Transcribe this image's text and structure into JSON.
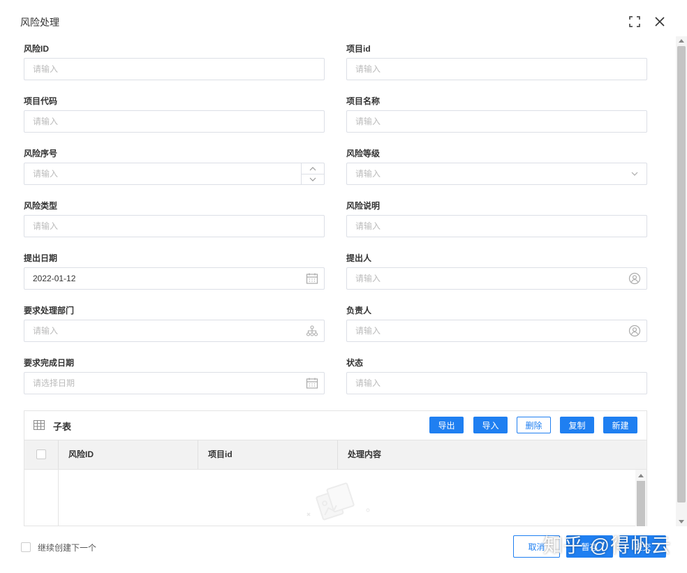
{
  "dialog": {
    "title": "风险处理"
  },
  "fields": {
    "risk_id": {
      "label": "风险ID",
      "placeholder": "请输入"
    },
    "project_id": {
      "label": "项目id",
      "placeholder": "请输入"
    },
    "project_code": {
      "label": "项目代码",
      "placeholder": "请输入"
    },
    "project_name": {
      "label": "项目名称",
      "placeholder": "请输入"
    },
    "risk_seq": {
      "label": "风险序号",
      "placeholder": "请输入"
    },
    "risk_level": {
      "label": "风险等级",
      "placeholder": "请输入"
    },
    "risk_type": {
      "label": "风险类型",
      "placeholder": "请输入"
    },
    "risk_desc": {
      "label": "风险说明",
      "placeholder": "请输入"
    },
    "submit_date": {
      "label": "提出日期",
      "value": "2022-01-12"
    },
    "submitter": {
      "label": "提出人",
      "placeholder": "请输入"
    },
    "required_dept": {
      "label": "要求处理部门",
      "placeholder": "请输入"
    },
    "owner": {
      "label": "负责人",
      "placeholder": "请输入"
    },
    "due_date": {
      "label": "要求完成日期",
      "placeholder": "请选择日期"
    },
    "status": {
      "label": "状态",
      "placeholder": "请输入"
    }
  },
  "subtable": {
    "title": "子表",
    "buttons": {
      "export": "导出",
      "import": "导入",
      "delete": "删除",
      "copy": "复制",
      "new": "新建"
    },
    "columns": [
      "风险ID",
      "项目id",
      "处理内容"
    ]
  },
  "footer": {
    "continue_label": "继续创建下一个",
    "cancel": "取消",
    "save_draft": "暂存",
    "submit": "提交"
  },
  "watermark": "知乎 @得帆云",
  "colors": {
    "primary": "#1f7ff1",
    "border": "#dcdfe6"
  }
}
